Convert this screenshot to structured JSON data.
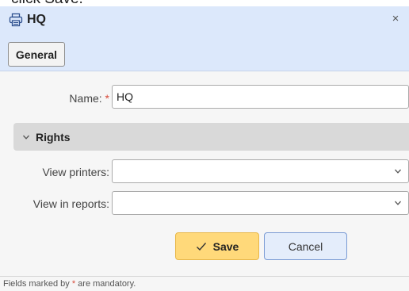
{
  "caption": "click Save.",
  "dialog": {
    "title": "HQ",
    "close_glyph": "×",
    "icon": "printer-icon"
  },
  "tabs": [
    {
      "label": "General"
    }
  ],
  "form": {
    "name_label": "Name:",
    "required_mark": "*",
    "name_value": "HQ"
  },
  "rights": {
    "section_label": "Rights",
    "view_printers_label": "View printers:",
    "view_printers_value": "",
    "view_in_reports_label": "View in reports:",
    "view_in_reports_value": ""
  },
  "actions": {
    "save_label": "Save",
    "cancel_label": "Cancel"
  },
  "footer": {
    "text_before": "Fields marked by",
    "required_mark": "*",
    "text_after": "are mandatory."
  },
  "colors": {
    "header_bg": "#dce8fb",
    "save_bg": "#ffd97a",
    "required": "#d84a3a"
  }
}
